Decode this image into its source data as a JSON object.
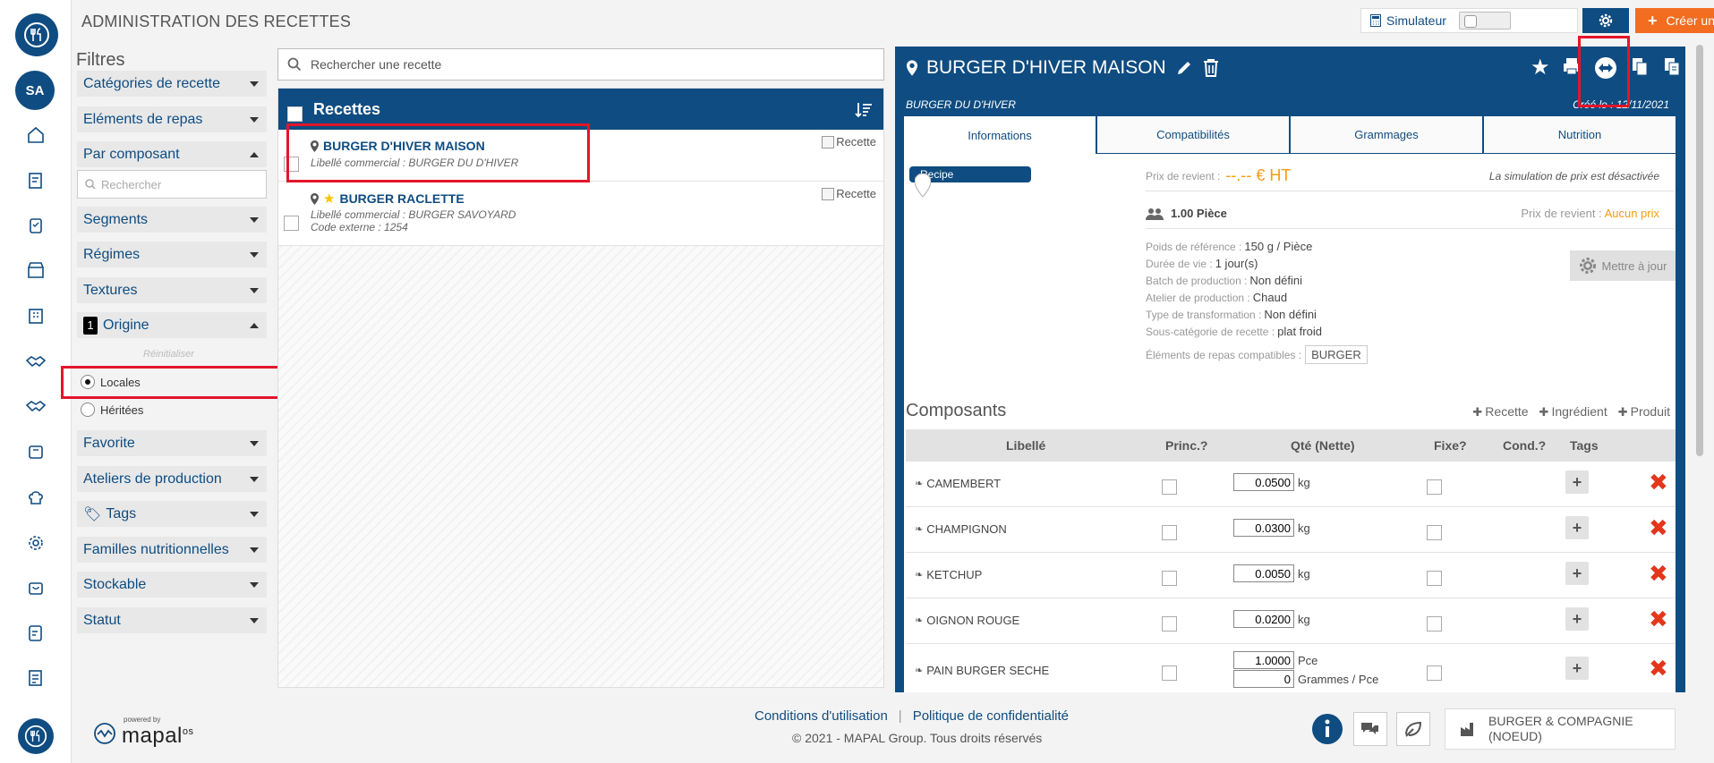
{
  "app": {
    "title": "ADMINISTRATION DES RECETTES",
    "user_initials": "SA",
    "simulator_label": "Simulateur",
    "create_label": "Créer une recette"
  },
  "filters": {
    "title": "Filtres",
    "search_placeholder": "Rechercher",
    "reset_label": "Réinitialiser",
    "origin_count": "1",
    "items": [
      "Catégories de recette",
      "Eléments de repas",
      "Par composant",
      "Segments",
      "Régimes",
      "Textures",
      "Origine",
      "Favorite",
      "Ateliers de production",
      "Tags",
      "Familles nutritionnelles",
      "Stockable",
      "Statut"
    ],
    "origin_options": [
      "Locales",
      "Héritées"
    ]
  },
  "list": {
    "search_placeholder": "Rechercher une recette",
    "header": "Recettes",
    "image_alt": "Recette",
    "rows": [
      {
        "name": "BURGER D'HIVER MAISON",
        "commercial": "Libellé commercial : BURGER DU D'HIVER",
        "external": ""
      },
      {
        "name": "BURGER RACLETTE",
        "commercial": "Libellé commercial : BURGER SAVOYARD",
        "external": "Code externe : 1254"
      }
    ]
  },
  "detail": {
    "title": "BURGER D'HIVER MAISON",
    "subtitle": "BURGER DU D'HIVER",
    "created": "Créé le : 12/11/2021",
    "tabs": [
      "Informations",
      "Compatibilités",
      "Grammages",
      "Nutrition"
    ],
    "image_alt": "Recipe",
    "price_label": "Prix de revient :",
    "price_value": "--.-- € HT",
    "simulation_note": "La simulation de prix est désactivée",
    "pieces": "1.00 Pièce",
    "pieces_price_label": "Prix de revient :",
    "pieces_price_value": "Aucun prix",
    "update_label": "Mettre à jour",
    "attributes": [
      {
        "label": "Poids de référence :",
        "value": "150 g / Pièce"
      },
      {
        "label": "Durée de vie :",
        "value": "1 jour(s)"
      },
      {
        "label": "Batch de production :",
        "value": "Non défini"
      },
      {
        "label": "Atelier de production :",
        "value": "Chaud"
      },
      {
        "label": "Type de transformation :",
        "value": "Non défini"
      },
      {
        "label": "Sous-catégorie de recette :",
        "value": "plat froid"
      }
    ],
    "compatible_label": "Éléments de repas compatibles :",
    "compatible_chip": "BURGER",
    "components_title": "Composants",
    "add_links": [
      "Recette",
      "Ingrédient",
      "Produit"
    ],
    "columns": [
      "Libellé",
      "Princ.?",
      "Qté (Nette)",
      "Fixe?",
      "Cond.?",
      "Tags"
    ],
    "components": [
      {
        "name": "CAMEMBERT",
        "qty": "0.0500",
        "unit": "kg"
      },
      {
        "name": "CHAMPIGNON",
        "qty": "0.0300",
        "unit": "kg"
      },
      {
        "name": "KETCHUP",
        "qty": "0.0050",
        "unit": "kg"
      },
      {
        "name": "OIGNON ROUGE",
        "qty": "0.0200",
        "unit": "kg"
      },
      {
        "name": "PAIN BURGER SECHE",
        "qty": "1.0000",
        "unit": "Pce",
        "qty2": "0",
        "unit2": "Grammes / Pce"
      }
    ]
  },
  "footer": {
    "powered_by": "powered by",
    "brand": "mapal",
    "brand_suffix": "os",
    "terms": "Conditions d'utilisation",
    "separator": "|",
    "privacy": "Politique de confidentialité",
    "copyright": "© 2021 - MAPAL Group. Tous droits réservés",
    "company_line1": "BURGER & COMPAGNIE",
    "company_line2": "(NOEUD)"
  },
  "colors": {
    "primary": "#0f4c81",
    "accent": "#f36d21",
    "highlight": "#e3152b",
    "price": "#f39c12"
  }
}
